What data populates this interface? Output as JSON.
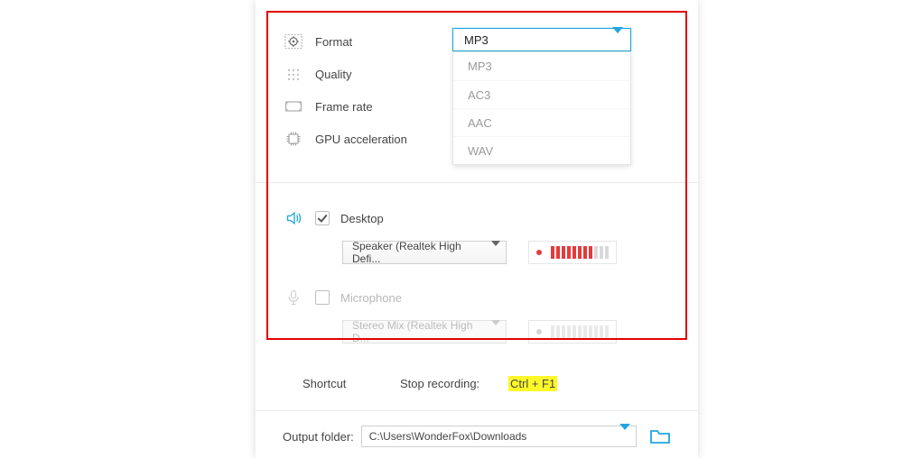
{
  "settings": {
    "format": {
      "label": "Format",
      "value": "MP3",
      "options": [
        "MP3",
        "AC3",
        "AAC",
        "WAV"
      ]
    },
    "quality": {
      "label": "Quality"
    },
    "frame_rate": {
      "label": "Frame rate"
    },
    "gpu_accel": {
      "label": "GPU acceleration"
    }
  },
  "audio": {
    "desktop": {
      "label": "Desktop",
      "checked": true,
      "device": "Speaker (Realtek High Defi...",
      "level_active_bars": 8,
      "level_total_bars": 11
    },
    "microphone": {
      "label": "Microphone",
      "checked": false,
      "device": "Stereo Mix (Realtek High D...",
      "level_active_bars": 0,
      "level_total_bars": 11
    }
  },
  "shortcut": {
    "label": "Shortcut",
    "stop_label": "Stop recording:",
    "stop_key": "Ctrl + F1"
  },
  "output": {
    "label": "Output folder:",
    "path": "C:\\Users\\WonderFox\\Downloads"
  }
}
